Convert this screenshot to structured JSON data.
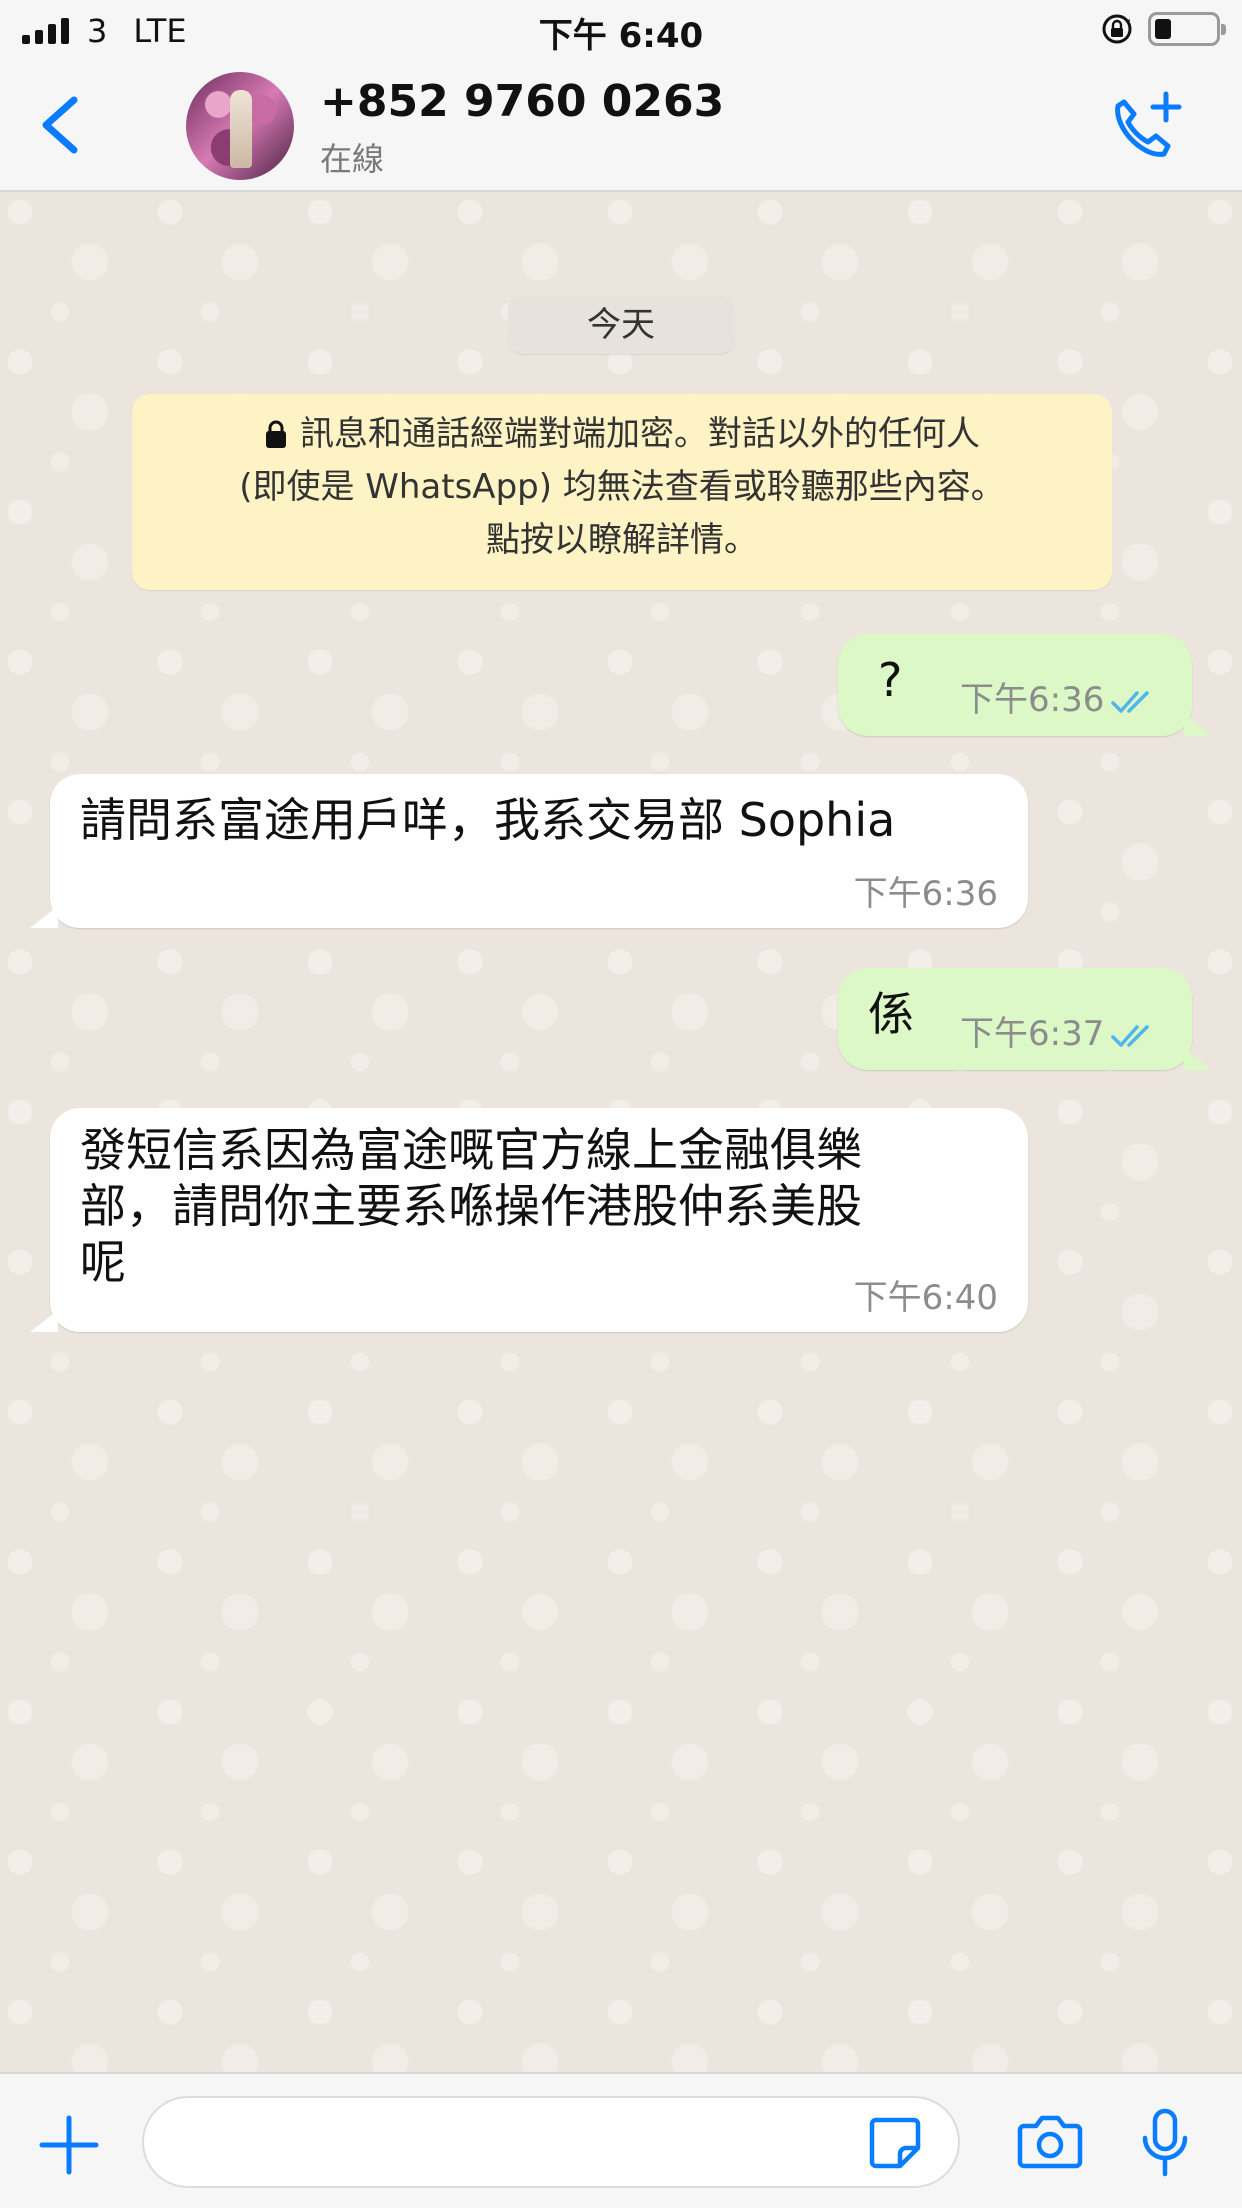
{
  "status_bar": {
    "carrier": "3",
    "network": "LTE",
    "time": "下午 6:40"
  },
  "header": {
    "contact_name": "+852 9760 0263",
    "contact_status": "在線"
  },
  "chat": {
    "date_label": "今天",
    "encryption_notice": {
      "line1": "訊息和通話經端對端加密。對話以外的任何人",
      "line2": "(即使是 WhatsApp) 均無法查看或聆聽那些內容。",
      "line3": "點按以瞭解詳情。"
    },
    "messages": [
      {
        "direction": "outgoing",
        "text": "?",
        "time": "下午6:36",
        "status": "read"
      },
      {
        "direction": "incoming",
        "text": "請問系富途用戶咩，我系交易部 Sophia",
        "time": "下午6:36"
      },
      {
        "direction": "outgoing",
        "text": "係",
        "time": "下午6:37",
        "status": "read"
      },
      {
        "direction": "incoming",
        "lines": [
          "發短信系因為富途嘅官方線上金融俱樂",
          "部，請問你主要系喺操作港股仲系美股",
          "呢"
        ],
        "time": "下午6:40"
      }
    ]
  },
  "colors": {
    "accent": "#0a7cff",
    "outgoing_bubble": "#dcf8c6",
    "incoming_bubble": "#ffffff",
    "chat_background": "#ece5dd",
    "notice_background": "#fdf3c5",
    "read_ticks": "#4fb6ec"
  },
  "icons": [
    "back-chevron-icon",
    "add-call-icon",
    "lock-icon",
    "read-ticks-icon",
    "plus-icon",
    "sticker-icon",
    "camera-icon",
    "microphone-icon"
  ]
}
